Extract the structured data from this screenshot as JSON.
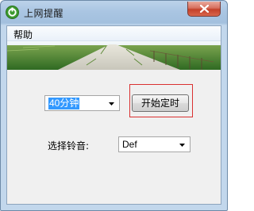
{
  "window": {
    "title": "上网提醒"
  },
  "menu": {
    "help": "帮助"
  },
  "timer": {
    "duration_value": "40分钟",
    "start_button": "开始定时"
  },
  "ringtone": {
    "label": "选择铃音:",
    "value": "Def"
  },
  "colors": {
    "highlight_box": "#d93030",
    "selection": "#3399ff"
  }
}
